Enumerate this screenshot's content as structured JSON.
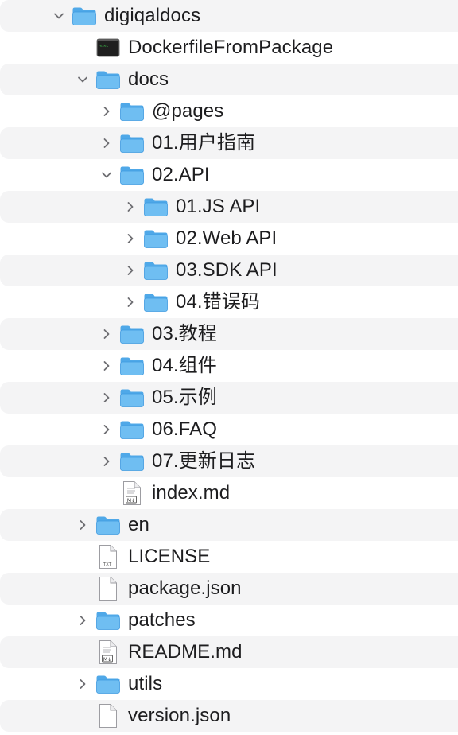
{
  "tree": {
    "rows": [
      {
        "label": "digiqaldocs",
        "depth": 0,
        "type": "folder",
        "expanded": true,
        "alt": true
      },
      {
        "label": "DockerfileFromPackage",
        "depth": 1,
        "type": "terminal",
        "alt": false
      },
      {
        "label": "docs",
        "depth": 1,
        "type": "folder",
        "expanded": true,
        "alt": true
      },
      {
        "label": "@pages",
        "depth": 2,
        "type": "folder",
        "expanded": false,
        "alt": false
      },
      {
        "label": "01.用户指南",
        "depth": 2,
        "type": "folder",
        "expanded": false,
        "alt": true
      },
      {
        "label": "02.API",
        "depth": 2,
        "type": "folder",
        "expanded": true,
        "alt": false
      },
      {
        "label": "01.JS API",
        "depth": 3,
        "type": "folder",
        "expanded": false,
        "alt": true
      },
      {
        "label": "02.Web API",
        "depth": 3,
        "type": "folder",
        "expanded": false,
        "alt": false
      },
      {
        "label": "03.SDK API",
        "depth": 3,
        "type": "folder",
        "expanded": false,
        "alt": true
      },
      {
        "label": "04.错误码",
        "depth": 3,
        "type": "folder",
        "expanded": false,
        "alt": false
      },
      {
        "label": "03.教程",
        "depth": 2,
        "type": "folder",
        "expanded": false,
        "alt": true
      },
      {
        "label": "04.组件",
        "depth": 2,
        "type": "folder",
        "expanded": false,
        "alt": false
      },
      {
        "label": "05.示例",
        "depth": 2,
        "type": "folder",
        "expanded": false,
        "alt": true
      },
      {
        "label": "06.FAQ",
        "depth": 2,
        "type": "folder",
        "expanded": false,
        "alt": false
      },
      {
        "label": "07.更新日志",
        "depth": 2,
        "type": "folder",
        "expanded": false,
        "alt": true
      },
      {
        "label": "index.md",
        "depth": 2,
        "type": "markdown",
        "alt": false
      },
      {
        "label": "en",
        "depth": 1,
        "type": "folder",
        "expanded": false,
        "alt": true
      },
      {
        "label": "LICENSE",
        "depth": 1,
        "type": "text",
        "alt": false
      },
      {
        "label": "package.json",
        "depth": 1,
        "type": "file",
        "alt": true
      },
      {
        "label": "patches",
        "depth": 1,
        "type": "folder",
        "expanded": false,
        "alt": false
      },
      {
        "label": "README.md",
        "depth": 1,
        "type": "markdown",
        "alt": true
      },
      {
        "label": "utils",
        "depth": 1,
        "type": "folder",
        "expanded": false,
        "alt": false
      },
      {
        "label": "version.json",
        "depth": 1,
        "type": "file",
        "alt": true
      }
    ]
  },
  "icons": {
    "folder": "folder-icon",
    "terminal": "terminal-file-icon",
    "markdown": "markdown-file-icon",
    "text": "text-file-icon",
    "file": "document-icon",
    "chevron_right": "chevron-right-icon",
    "chevron_down": "chevron-down-icon"
  },
  "text_badges": {
    "txt": "TXT",
    "md": "M↓",
    "terminal": "exec"
  },
  "colors": {
    "folder_front": "#6fbef2",
    "folder_back": "#4fa8e8",
    "folder_outline": "#3f9ae0",
    "stripe": "#f4f4f5",
    "text": "#1d1d1f",
    "chevron": "#6e6e73"
  }
}
